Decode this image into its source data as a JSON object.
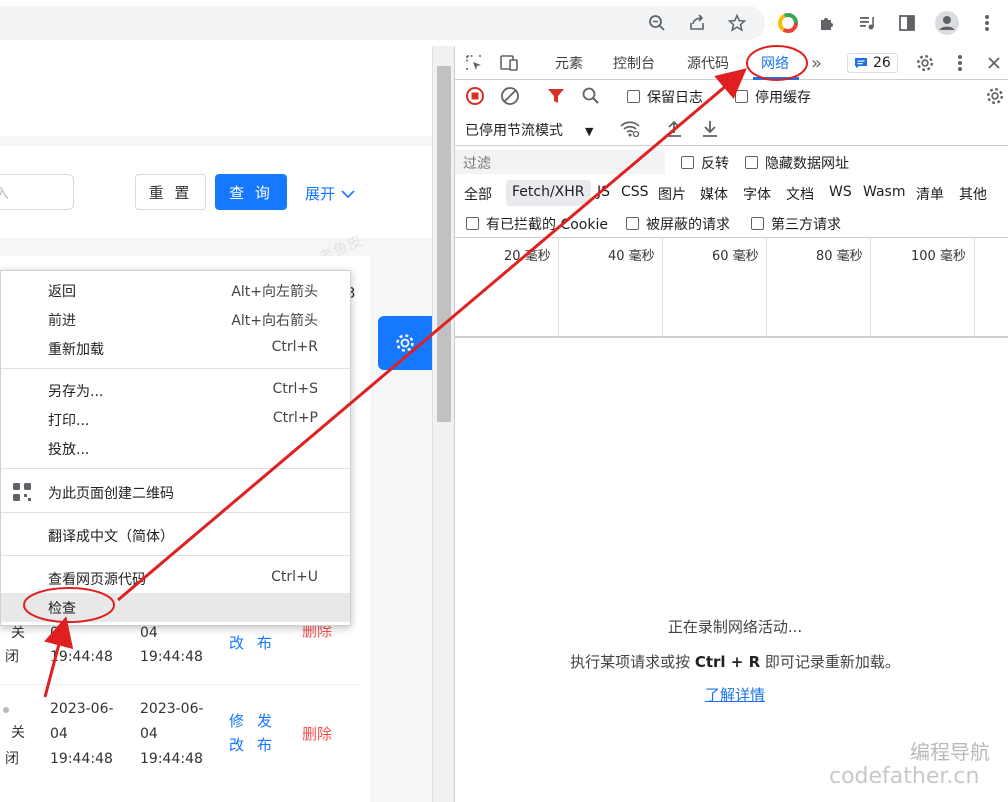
{
  "browser": {
    "toolbar_icons": [
      "zoom-icon",
      "share-icon",
      "bookmark-star-icon",
      "chrome-color-icon",
      "extensions-icon",
      "media-icon",
      "side-panel-icon",
      "profile-icon",
      "more-icon"
    ]
  },
  "page": {
    "input_placeholder": "入",
    "reset_label": "重 置",
    "query_label": "查 询",
    "expand_label": "展开",
    "watermark": "老鱼皮",
    "row_top": {
      "status_part1": "关",
      "status_part2": "闭",
      "date1": "0",
      "time1": "19:44:48",
      "date2": "04",
      "time2": "19:44:48",
      "edit1": "修",
      "edit2": "改",
      "publish1": "发",
      "publish2": "布",
      "delete": "删除"
    },
    "row_bottom": {
      "status_part1": "关",
      "status_part2": "闭",
      "date1_a": "2023-06-",
      "date1_b": "04",
      "time1": "19:44:48",
      "date2_a": "2023-06-",
      "date2_b": "04",
      "time2": "19:44:48",
      "edit1": "修",
      "edit2": "改",
      "publish1": "发",
      "publish2": "布",
      "delete": "删除"
    },
    "side_number": "3"
  },
  "context_menu": {
    "items": [
      {
        "label": "返回",
        "shortcut": "Alt+向左箭头"
      },
      {
        "label": "前进",
        "shortcut": "Alt+向右箭头"
      },
      {
        "label": "重新加载",
        "shortcut": "Ctrl+R"
      },
      {
        "label": "另存为...",
        "shortcut": "Ctrl+S"
      },
      {
        "label": "打印...",
        "shortcut": "Ctrl+P"
      },
      {
        "label": "投放...",
        "shortcut": ""
      },
      {
        "label": "为此页面创建二维码",
        "shortcut": ""
      },
      {
        "label": "翻译成中文（简体）",
        "shortcut": ""
      },
      {
        "label": "查看网页源代码",
        "shortcut": "Ctrl+U"
      },
      {
        "label": "检查",
        "shortcut": ""
      }
    ]
  },
  "devtools": {
    "tabs": [
      "元素",
      "控制台",
      "源代码",
      "网络"
    ],
    "active_tab": "网络",
    "issues_count": "26",
    "preserve_log": "保留日志",
    "disable_cache": "停用缓存",
    "throttle": "已停用节流模式",
    "filter_placeholder": "过滤",
    "invert": "反转",
    "hide_data_urls": "隐藏数据网址",
    "type_filters": [
      "全部",
      "Fetch/XHR",
      "JS",
      "CSS",
      "图片",
      "媒体",
      "字体",
      "文档",
      "WS",
      "Wasm",
      "清单",
      "其他"
    ],
    "blocked_cookies": "有已拦截的 Cookie",
    "blocked_requests": "被屏蔽的请求",
    "third_party": "第三方请求",
    "timeline_ticks": [
      "20 毫秒",
      "40 毫秒",
      "60 毫秒",
      "80 毫秒",
      "100 毫秒"
    ],
    "recording_text": "正在录制网络活动...",
    "hint_prefix": "执行某项请求或按",
    "hint_shortcut": "Ctrl + R",
    "hint_suffix": "即可记录重新加载。",
    "learn_more": "了解详情"
  },
  "watermark_site": {
    "line1": "编程导航",
    "line2": "codefather.cn"
  },
  "colors": {
    "primary": "#1677ff",
    "danger": "#ff4d4f",
    "annotation": "#e02020",
    "devtools_blue": "#1a73e8"
  }
}
